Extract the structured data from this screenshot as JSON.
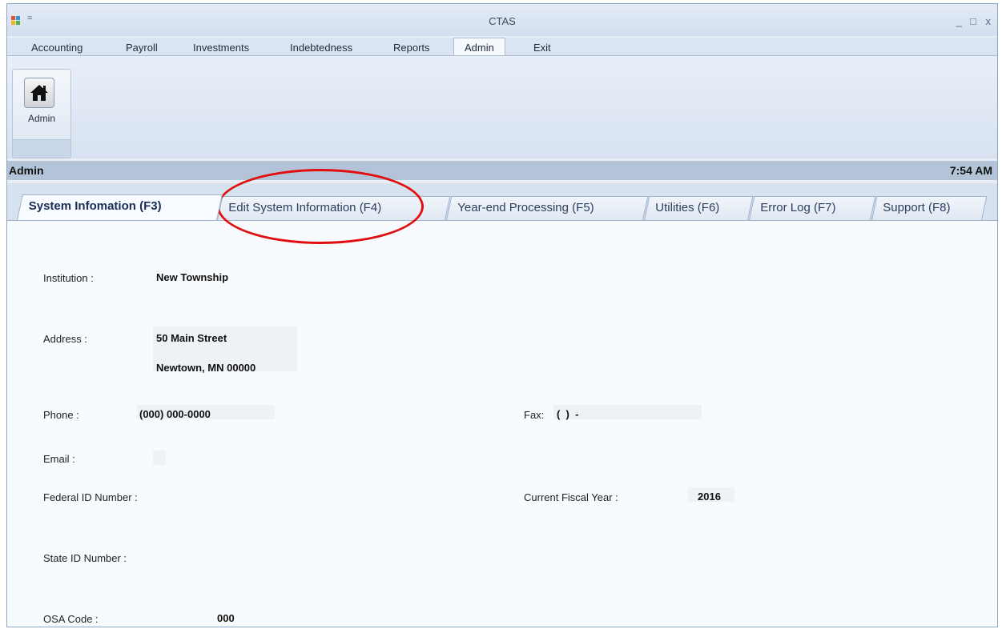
{
  "window": {
    "title": "CTAS",
    "controls": {
      "minimize": "_",
      "maximize": "□",
      "close": "x"
    },
    "qat": "="
  },
  "menu": [
    "Accounting",
    "Payroll",
    "Investments",
    "Indebtedness",
    "Reports",
    "Admin",
    "Exit"
  ],
  "ribbon": {
    "button_label": "Admin"
  },
  "status": {
    "left": "Admin",
    "time": "7:54 AM"
  },
  "tabs": [
    "System Infomation (F3)",
    "Edit System Information (F4)",
    "Year-end Processing  (F5)",
    "Utilities (F6)",
    "Error Log (F7)",
    "Support (F8)"
  ],
  "info": {
    "institution_label": "Institution :",
    "institution_value": "New Township",
    "address_label": "Address :",
    "address_line1": "50 Main Street",
    "address_line2": "Newtown, MN  00000",
    "phone_label": "Phone :",
    "phone_value": "(000) 000-0000",
    "fax_label": "Fax:",
    "fax_value": "(  )  -",
    "email_label": "Email :",
    "email_value": "",
    "federal_label": "Federal ID Number :",
    "federal_value": "",
    "fiscal_label": "Current Fiscal Year :",
    "fiscal_value": "2016",
    "state_label": "State ID Number :",
    "state_value": "",
    "osa_label": "OSA Code :",
    "osa_value": "000"
  },
  "colors": {
    "annotation": "#e01010",
    "status_bar": "#b4c4d8",
    "tab_text": "#2c3e5c"
  }
}
